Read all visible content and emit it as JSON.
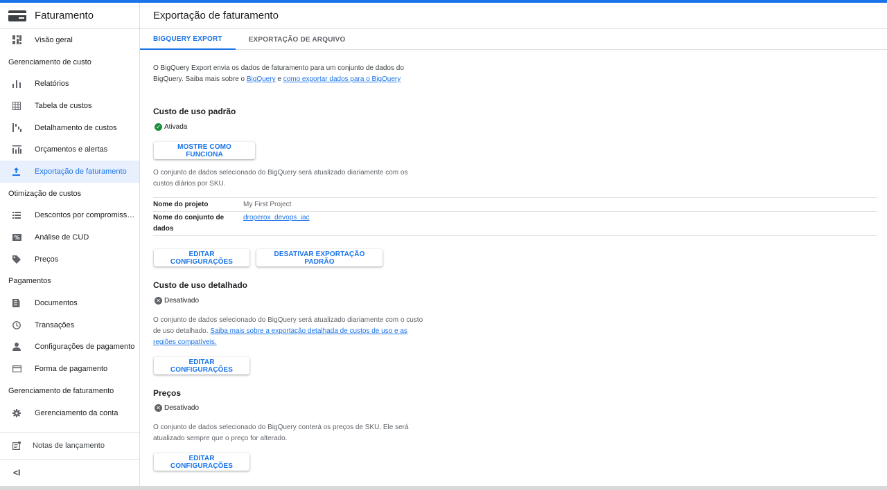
{
  "sidebar": {
    "title": "Faturamento",
    "overview": "Visão geral",
    "sections": {
      "cost_mgmt": "Gerenciamento de custo",
      "cost_opt": "Otimização de custos",
      "payments": "Pagamentos",
      "billing_mgmt": "Gerenciamento de faturamento"
    },
    "items": {
      "reports": "Relatórios",
      "cost_table": "Tabela de custos",
      "cost_breakdown": "Detalhamento de custos",
      "budgets": "Orçamentos e alertas",
      "billing_export": "Exportação de faturamento",
      "commit_discounts": "Descontos por compromiss…",
      "cud_analysis": "Análise de CUD",
      "pricing": "Preços",
      "documents": "Documentos",
      "transactions": "Transações",
      "payment_settings": "Configurações de pagamento",
      "payment_method": "Forma de pagamento",
      "account_mgmt": "Gerenciamento da conta"
    },
    "release_notes": "Notas de lançamento",
    "collapse": "<I"
  },
  "page": {
    "title": "Exportação de faturamento",
    "tabs": [
      "BIGQUERY EXPORT",
      "EXPORTAÇÃO DE ARQUIVO"
    ],
    "intro": {
      "text1": "O BigQuery Export envia os dados de faturamento para um conjunto de dados do",
      "text2": "BigQuery. Saiba mais sobre o ",
      "link1": "BigQuery",
      "text3": " e ",
      "link2": "como exportar dados para o BigQuery"
    },
    "standard": {
      "heading": "Custo de uso padrão",
      "status": "Ativada",
      "show_button": "MOSTRE COMO FUNCIONA",
      "desc1": "O conjunto de dados selecionado do BigQuery será atualizado diariamente com os",
      "desc2": "custos diários por SKU.",
      "project_label": "Nome do projeto",
      "project_value": "My First Project",
      "dataset_label1": "Nome do conjunto de",
      "dataset_label2": "dados",
      "dataset_value": "droperox_devops_iac",
      "edit_button": "EDITAR CONFIGURAÇÕES",
      "disable_button": "DESATIVAR EXPORTAÇÃO PADRÃO"
    },
    "detailed": {
      "heading": "Custo de uso detalhado",
      "status": "Desativado",
      "desc1": "O conjunto de dados selecionado do BigQuery será atualizado diariamente com o custo",
      "desc2": "de uso detalhado. ",
      "link1": "Saiba mais sobre a exportação detalhada de custos de uso e as",
      "link2": "regiões compatíveis.",
      "edit_button": "EDITAR CONFIGURAÇÕES"
    },
    "pricing": {
      "heading": "Preços",
      "status": "Desativado",
      "desc1": "O conjunto de dados selecionado do BigQuery conterá os preços de SKU. Ele será",
      "desc2": "atualizado sempre que o preço for alterado.",
      "edit_button": "EDITAR CONFIGURAÇÕES"
    }
  }
}
